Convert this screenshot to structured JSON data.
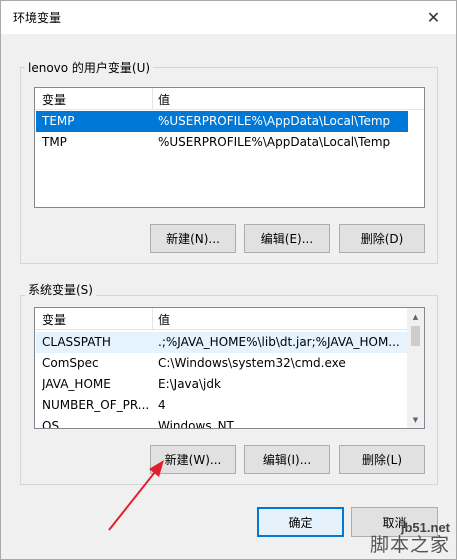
{
  "window": {
    "title": "环境变量",
    "close_symbol": "✕"
  },
  "user_vars": {
    "group_label": "lenovo 的用户变量(U)",
    "columns": [
      "变量",
      "值"
    ],
    "rows": [
      {
        "name": "TEMP",
        "value": "%USERPROFILE%\\AppData\\Local\\Temp",
        "selected": true
      },
      {
        "name": "TMP",
        "value": "%USERPROFILE%\\AppData\\Local\\Temp",
        "selected": false
      }
    ],
    "buttons": {
      "new": "新建(N)...",
      "edit": "编辑(E)...",
      "delete": "删除(D)"
    }
  },
  "system_vars": {
    "group_label": "系统变量(S)",
    "columns": [
      "变量",
      "值"
    ],
    "rows": [
      {
        "name": "CLASSPATH",
        "value": ".;%JAVA_HOME%\\lib\\dt.jar;%JAVA_HOM...",
        "hover": true
      },
      {
        "name": "ComSpec",
        "value": "C:\\Windows\\system32\\cmd.exe"
      },
      {
        "name": "JAVA_HOME",
        "value": "E:\\Java\\jdk"
      },
      {
        "name": "NUMBER_OF_PR...",
        "value": "4"
      },
      {
        "name": "OS",
        "value": "Windows_NT"
      }
    ],
    "buttons": {
      "new": "新建(W)...",
      "edit": "编辑(I)...",
      "delete": "删除(L)"
    }
  },
  "footer": {
    "ok": "确定",
    "cancel": "取消"
  },
  "watermark": {
    "url": "jb51.net",
    "text": "脚本之家"
  },
  "colors": {
    "selection": "#0078d7",
    "hover": "#e5f3ff",
    "arrow": "#e0202c"
  }
}
